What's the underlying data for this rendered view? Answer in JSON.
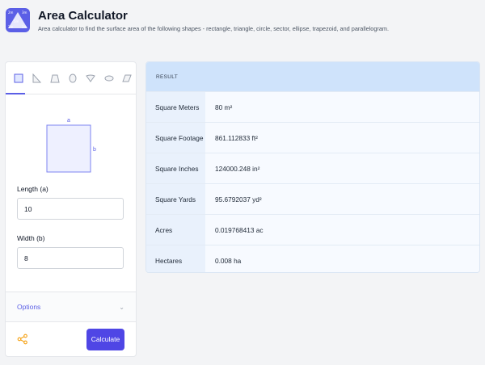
{
  "header": {
    "logo_labels": [
      "2m",
      "3m",
      "5m",
      "2m",
      "2m"
    ],
    "title": "Area Calculator",
    "subtitle": "Area calculator to find the surface area of the following shapes - rectangle, triangle, circle, sector, ellipse, trapezoid, and parallelogram."
  },
  "shapes": {
    "selected": "rectangle",
    "tabs": [
      "rectangle-icon",
      "triangle-icon",
      "trapezoid-icon",
      "circle-icon",
      "sector-icon",
      "ellipse-icon",
      "parallelogram-icon"
    ]
  },
  "diagram": {
    "label_a": "a",
    "label_b": "b"
  },
  "form": {
    "length_label": "Length (a)",
    "length_value": "10",
    "width_label": "Width (b)",
    "width_value": "8"
  },
  "options": {
    "label": "Options",
    "chevron": "⌄"
  },
  "actions": {
    "calculate_label": "Calculate"
  },
  "result": {
    "header": "RESULT",
    "rows": [
      {
        "label": "Square Meters",
        "value": "80 m²"
      },
      {
        "label": "Square Footage",
        "value": "861.112833 ft²"
      },
      {
        "label": "Square Inches",
        "value": "124000.248 in²"
      },
      {
        "label": "Square Yards",
        "value": "95.6792037 yd²"
      },
      {
        "label": "Acres",
        "value": "0.019768413 ac"
      },
      {
        "label": "Hectares",
        "value": "0.008 ha"
      }
    ]
  },
  "colors": {
    "accent": "#5b5fe6",
    "button": "#4f46e5",
    "result_header": "#cfe3fb",
    "result_key_bg": "#e9f1fc"
  }
}
